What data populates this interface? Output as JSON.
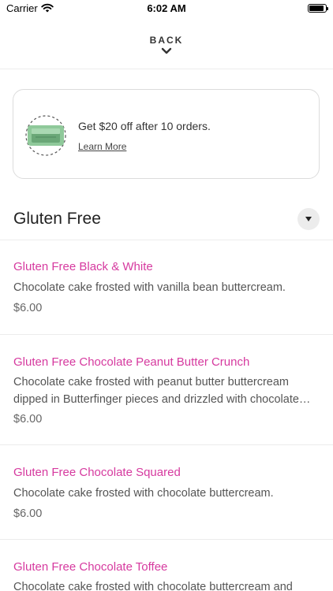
{
  "status": {
    "carrier": "Carrier",
    "time": "6:02 AM"
  },
  "nav": {
    "back_label": "BACK"
  },
  "promo": {
    "text": "Get $20 off after 10 orders.",
    "link": "Learn More"
  },
  "section": {
    "title": "Gluten Free"
  },
  "items": [
    {
      "name": "Gluten Free Black & White",
      "description": "Chocolate cake frosted with vanilla bean buttercream.",
      "price": "$6.00"
    },
    {
      "name": "Gluten Free Chocolate Peanut Butter Crunch",
      "description": "Chocolate cake frosted with peanut butter buttercream dipped in Butterfinger pieces and drizzled with chocolate ganache.",
      "price": "$6.00"
    },
    {
      "name": "Gluten Free Chocolate Squared",
      "description": "Chocolate cake frosted with chocolate buttercream.",
      "price": "$6.00"
    },
    {
      "name": "Gluten Free Chocolate Toffee",
      "description": "Chocolate cake frosted with chocolate buttercream and",
      "price": ""
    }
  ],
  "colors": {
    "item_name": "#d63a9f",
    "promo_icon": "#8fc99a"
  }
}
